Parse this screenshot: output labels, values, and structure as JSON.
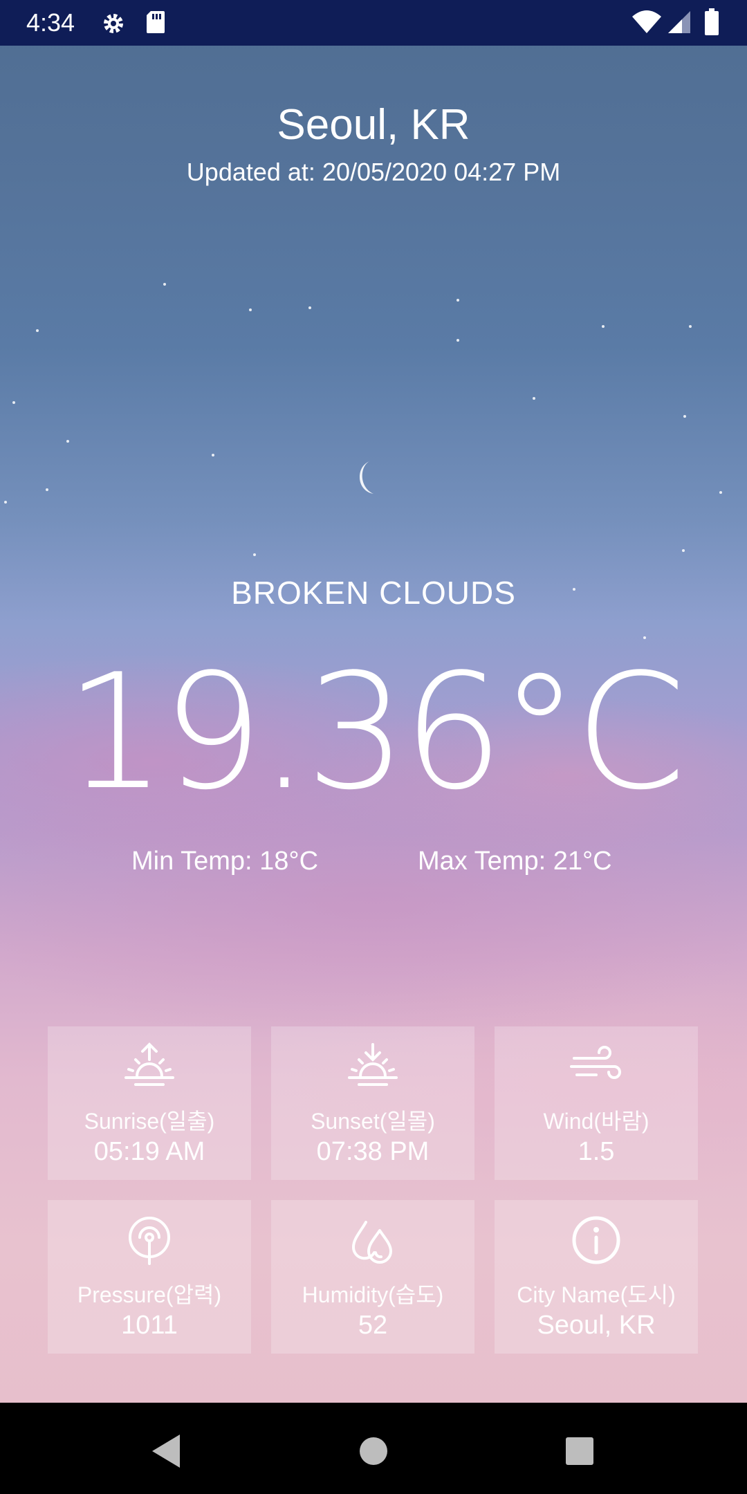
{
  "status_bar": {
    "time": "4:34",
    "icons": [
      "gear-icon",
      "sd-card-icon",
      "wifi-icon",
      "cell-signal-icon",
      "battery-icon"
    ]
  },
  "header": {
    "city": "Seoul, KR",
    "updated_at": "Updated at: 20/05/2020 04:27 PM"
  },
  "weather": {
    "condition": "BROKEN CLOUDS",
    "temperature": "19.36°C",
    "min_temp": "Min Temp: 18°C",
    "max_temp": "Max Temp: 21°C"
  },
  "details": [
    {
      "icon": "sunrise-icon",
      "label": "Sunrise(일출)",
      "value": "05:19 AM"
    },
    {
      "icon": "sunset-icon",
      "label": "Sunset(일몰)",
      "value": "07:38 PM"
    },
    {
      "icon": "wind-icon",
      "label": "Wind(바람)",
      "value": "1.5"
    },
    {
      "icon": "pressure-icon",
      "label": "Pressure(압력)",
      "value": "1011"
    },
    {
      "icon": "humidity-icon",
      "label": "Humidity(습도)",
      "value": "52"
    },
    {
      "icon": "info-icon",
      "label": "City Name(도시)",
      "value": "Seoul, KR"
    }
  ],
  "nav_bar": {
    "buttons": [
      "back-icon",
      "home-icon",
      "recents-icon"
    ]
  },
  "colors": {
    "status_bar": "#0f1d57",
    "text": "#ffffff"
  }
}
